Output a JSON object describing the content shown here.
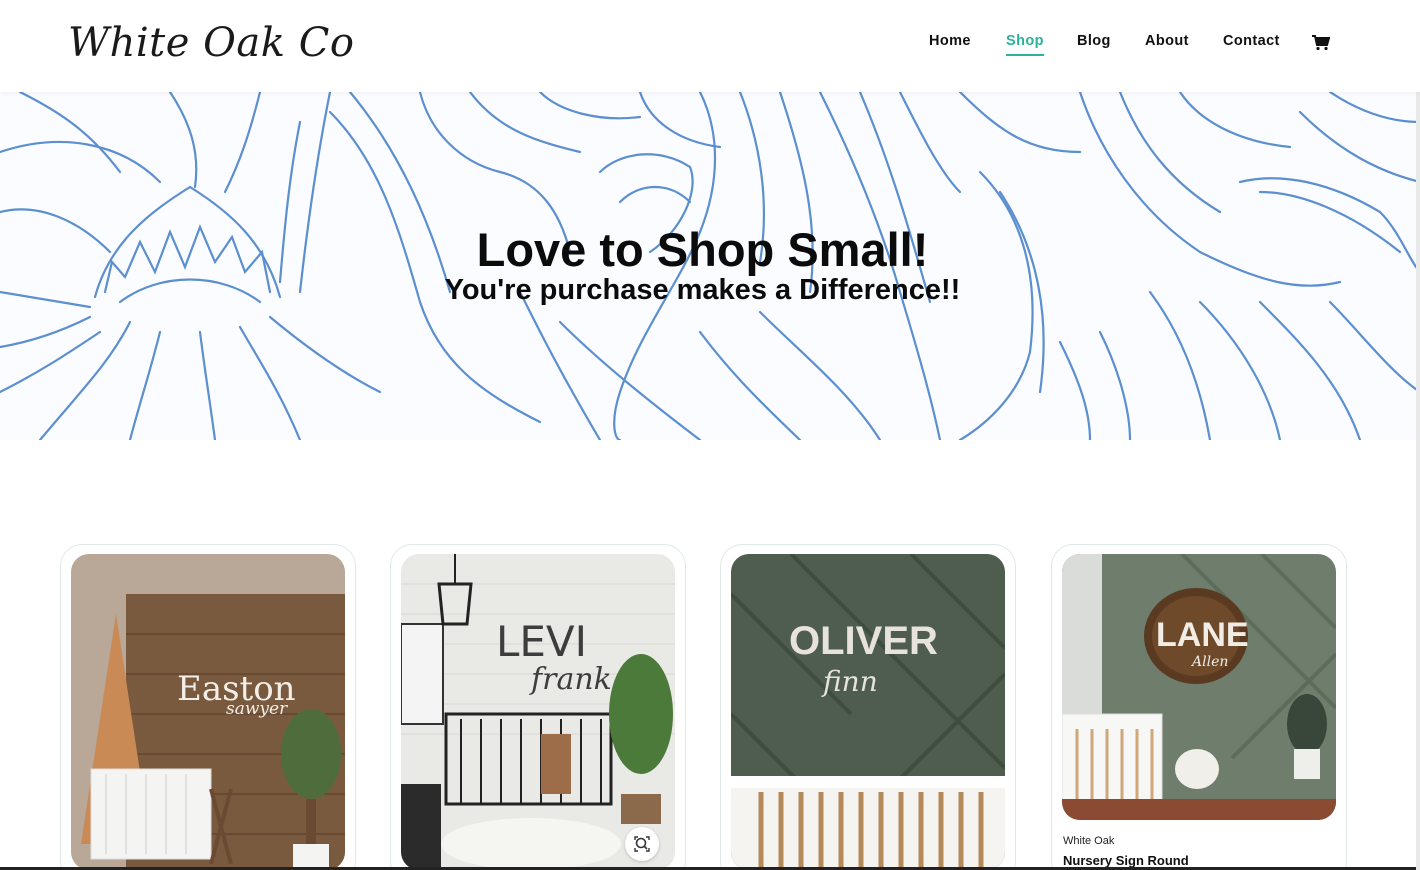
{
  "header": {
    "logo": "White Oak Co",
    "nav": [
      {
        "label": "Home"
      },
      {
        "label": "Shop"
      },
      {
        "label": "Blog"
      },
      {
        "label": "About"
      },
      {
        "label": "Contact"
      }
    ],
    "active_nav": "Shop",
    "cart_icon": "shopping-cart-icon",
    "accent_color": "#2ab29a"
  },
  "hero": {
    "title": "Love to Shop Small!",
    "subtitle": "You're purchase makes a Difference!!",
    "pattern_color": "#5b8fcf"
  },
  "products": [
    {
      "image_text": "Easton",
      "image_script": "sawyer"
    },
    {
      "image_text": "LEVI",
      "image_script": "frank"
    },
    {
      "image_text": "OLIVER",
      "image_script": "finn"
    },
    {
      "image_text": "LANE",
      "image_script": "Allen",
      "vendor": "White Oak",
      "name": "Nursery Sign Round"
    }
  ]
}
